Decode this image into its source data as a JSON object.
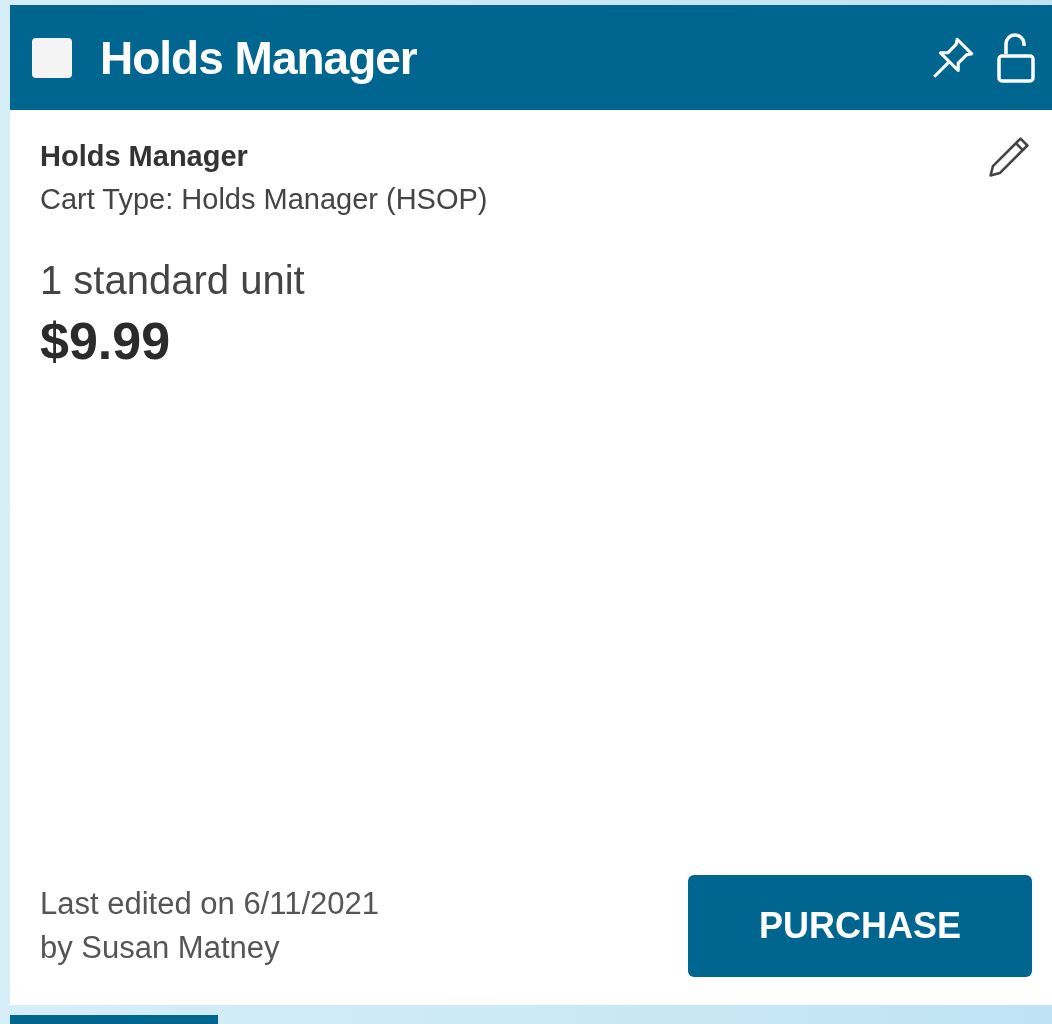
{
  "header": {
    "title": "Holds Manager",
    "checkbox": {
      "checked": false
    }
  },
  "cart": {
    "name": "Holds Manager",
    "cart_type": "Cart Type: Holds Manager (HSOP)",
    "quantity": "1 standard unit",
    "price": "$9.99"
  },
  "footer": {
    "edited": "Last edited on 6/11/2021",
    "editor": "by Susan Matney",
    "button": "PURCHASE"
  }
}
